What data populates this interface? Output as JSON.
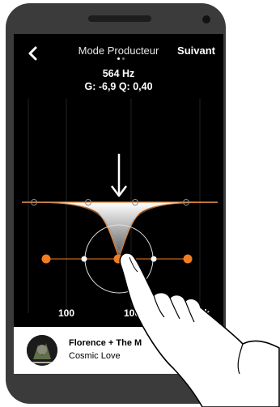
{
  "header": {
    "title": "Mode Producteur",
    "next_label": "Suivant"
  },
  "band_info": {
    "frequency": "564 Hz",
    "gain_q": "G: -6,9  Q: 0,40"
  },
  "axis_labels": [
    "100",
    "100",
    "10k"
  ],
  "player": {
    "song_title": "Florence + The M",
    "song_subtitle": "Cosmic Love"
  },
  "colors": {
    "accent": "#f07d22",
    "background": "#000000"
  }
}
